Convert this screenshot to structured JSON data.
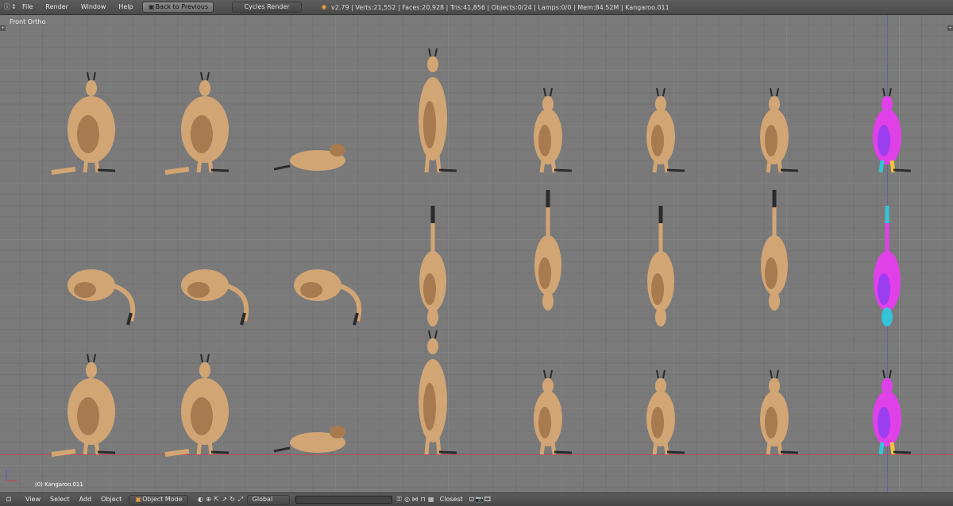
{
  "topbar": {
    "menu": [
      "File",
      "Render",
      "Window",
      "Help"
    ],
    "back_button": "Back to Previous",
    "render_engine": "Cycles Render",
    "stats": "v2.79 | Verts:21,552 | Faces:20,928 | Tris:41,856 | Objects:0/24 | Lamps:0/0 | Mem:84.52M | Kangaroo.011"
  },
  "viewport": {
    "view_label": "Front Ortho",
    "object_label": "(0) Kangaroo.011",
    "kangaroo_color": "#d2a574",
    "kangaroo_shadow": "#a87a4f",
    "foot_color": "#2b2b2b",
    "highlight_colors": [
      "#e040e8",
      "#9a3ef0",
      "#35c3d8",
      "#f2c33b"
    ],
    "axis_x_color": "#b0545a",
    "axis_z_color": "#5e62a8"
  },
  "bottombar": {
    "menu": [
      "View",
      "Select",
      "Add",
      "Object"
    ],
    "mode": "Object Mode",
    "orientation": "Global",
    "snap": "Closest"
  }
}
